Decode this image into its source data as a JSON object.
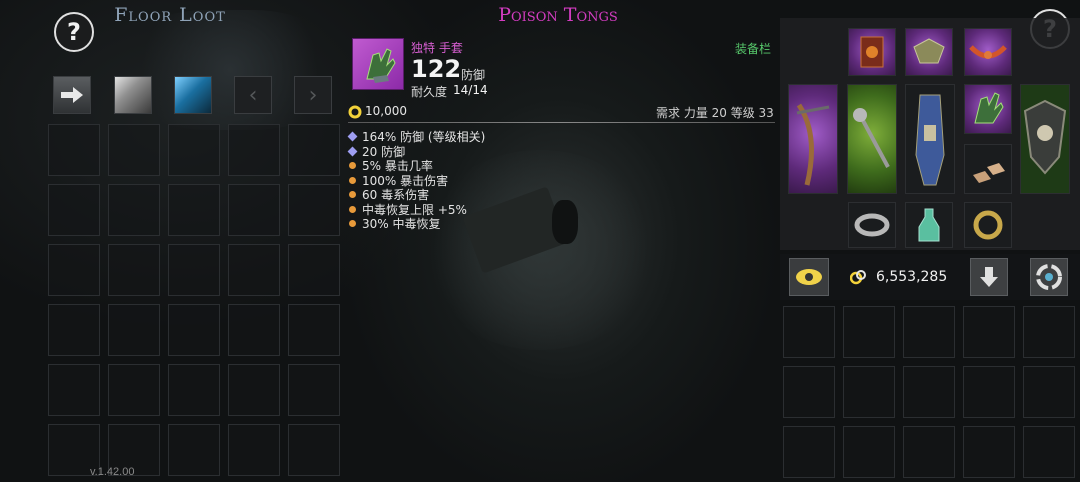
{
  "floor_loot": {
    "title": "Floor Loot",
    "filters": [
      {
        "name": "transfer-all",
        "icon": "arrow-right-icon"
      },
      {
        "name": "common-filter",
        "icon": "gray-swatch-icon"
      },
      {
        "name": "rare-filter",
        "icon": "blue-swatch-icon"
      },
      {
        "name": "prev-page",
        "icon": "chevron-left-icon",
        "glyph": "‹"
      },
      {
        "name": "next-page",
        "icon": "chevron-right-icon",
        "glyph": "›"
      }
    ],
    "grid": {
      "rows": 6,
      "cols": 5
    }
  },
  "help": {
    "label": "?"
  },
  "item": {
    "title": "Poison Tongs",
    "rarity": "独特 手套",
    "defense_value": "122",
    "defense_label": "防御",
    "durability_label": "耐久度",
    "durability_value": "14/14",
    "equip_label": "装备栏",
    "price": "10,000",
    "requirements": "需求 力量 20 等级 33",
    "attributes": [
      {
        "marker": "diamond",
        "text": "164% 防御 (等级相关)"
      },
      {
        "marker": "diamond",
        "text": "20 防御"
      },
      {
        "marker": "dot",
        "text": "5% 暴击几率"
      },
      {
        "marker": "dot",
        "text": "100% 暴击伤害"
      },
      {
        "marker": "dot",
        "text": "60 毒系伤害"
      },
      {
        "marker": "dot",
        "text": "中毒恢复上限 +5%"
      },
      {
        "marker": "dot",
        "text": "30% 中毒恢复"
      }
    ],
    "colors": {
      "title": "#d23cc0",
      "rarity": "#d65ed1",
      "equip": "#57c86b",
      "dot_marker": "#e89a3a",
      "diamond_marker": "#9e9ef2"
    }
  },
  "equipment": {
    "slots": [
      {
        "name": "spellbook-slot",
        "icon": "spellbook-icon"
      },
      {
        "name": "helmet-slot",
        "icon": "winged-helmet-icon"
      },
      {
        "name": "amulet-slot",
        "icon": "necklace-icon"
      },
      {
        "name": "crossbow-slot",
        "icon": "crossbow-icon"
      },
      {
        "name": "staff-slot",
        "icon": "mace-staff-icon"
      },
      {
        "name": "armor-slot",
        "icon": "robe-armor-icon"
      },
      {
        "name": "gloves-slot",
        "icon": "gloves-icon"
      },
      {
        "name": "shield-slot",
        "icon": "skull-shield-icon"
      },
      {
        "name": "boots-slot",
        "icon": "boots-icon"
      },
      {
        "name": "ring-left-slot",
        "icon": "ring-icon"
      },
      {
        "name": "potion-slot",
        "icon": "potion-icon"
      },
      {
        "name": "ring-right-slot",
        "icon": "ring-icon"
      }
    ]
  },
  "inventory": {
    "gold": "6,553,285",
    "grid": {
      "rows": 3,
      "cols": 5
    }
  },
  "version": "v.1.42.00"
}
